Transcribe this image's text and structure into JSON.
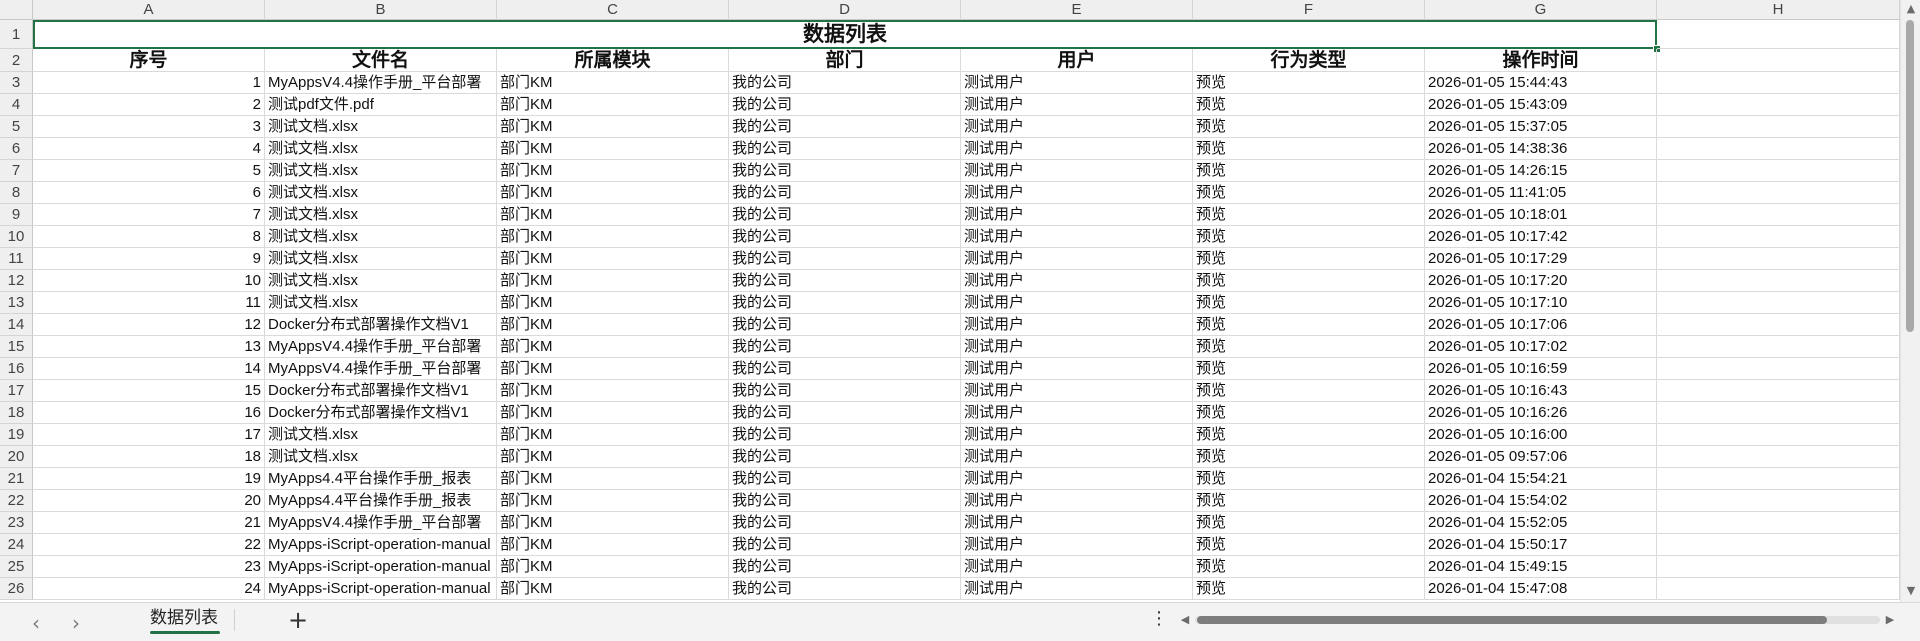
{
  "window": {
    "vscroll_up_icon": "▲",
    "vscroll_down_icon": "▼"
  },
  "sheet": {
    "columns": [
      "A",
      "B",
      "C",
      "D",
      "E",
      "F",
      "G",
      "H"
    ],
    "title": "数据列表",
    "headers": [
      "序号",
      "文件名",
      "所属模块",
      "部门",
      "用户",
      "行为类型",
      "操作时间"
    ],
    "rows": [
      [
        "1",
        "MyAppsV4.4操作手册_平台部署",
        "部门KM",
        "我的公司",
        "测试用户",
        "预览",
        "2026-01-05 15:44:43"
      ],
      [
        "2",
        "测试pdf文件.pdf",
        "部门KM",
        "我的公司",
        "测试用户",
        "预览",
        "2026-01-05 15:43:09"
      ],
      [
        "3",
        "测试文档.xlsx",
        "部门KM",
        "我的公司",
        "测试用户",
        "预览",
        "2026-01-05 15:37:05"
      ],
      [
        "4",
        "测试文档.xlsx",
        "部门KM",
        "我的公司",
        "测试用户",
        "预览",
        "2026-01-05 14:38:36"
      ],
      [
        "5",
        "测试文档.xlsx",
        "部门KM",
        "我的公司",
        "测试用户",
        "预览",
        "2026-01-05 14:26:15"
      ],
      [
        "6",
        "测试文档.xlsx",
        "部门KM",
        "我的公司",
        "测试用户",
        "预览",
        "2026-01-05 11:41:05"
      ],
      [
        "7",
        "测试文档.xlsx",
        "部门KM",
        "我的公司",
        "测试用户",
        "预览",
        "2026-01-05 10:18:01"
      ],
      [
        "8",
        "测试文档.xlsx",
        "部门KM",
        "我的公司",
        "测试用户",
        "预览",
        "2026-01-05 10:17:42"
      ],
      [
        "9",
        "测试文档.xlsx",
        "部门KM",
        "我的公司",
        "测试用户",
        "预览",
        "2026-01-05 10:17:29"
      ],
      [
        "10",
        "测试文档.xlsx",
        "部门KM",
        "我的公司",
        "测试用户",
        "预览",
        "2026-01-05 10:17:20"
      ],
      [
        "11",
        "测试文档.xlsx",
        "部门KM",
        "我的公司",
        "测试用户",
        "预览",
        "2026-01-05 10:17:10"
      ],
      [
        "12",
        "Docker分布式部署操作文档V1",
        "部门KM",
        "我的公司",
        "测试用户",
        "预览",
        "2026-01-05 10:17:06"
      ],
      [
        "13",
        "MyAppsV4.4操作手册_平台部署",
        "部门KM",
        "我的公司",
        "测试用户",
        "预览",
        "2026-01-05 10:17:02"
      ],
      [
        "14",
        "MyAppsV4.4操作手册_平台部署",
        "部门KM",
        "我的公司",
        "测试用户",
        "预览",
        "2026-01-05 10:16:59"
      ],
      [
        "15",
        "Docker分布式部署操作文档V1",
        "部门KM",
        "我的公司",
        "测试用户",
        "预览",
        "2026-01-05 10:16:43"
      ],
      [
        "16",
        "Docker分布式部署操作文档V1",
        "部门KM",
        "我的公司",
        "测试用户",
        "预览",
        "2026-01-05 10:16:26"
      ],
      [
        "17",
        "测试文档.xlsx",
        "部门KM",
        "我的公司",
        "测试用户",
        "预览",
        "2026-01-05 10:16:00"
      ],
      [
        "18",
        "测试文档.xlsx",
        "部门KM",
        "我的公司",
        "测试用户",
        "预览",
        "2026-01-05 09:57:06"
      ],
      [
        "19",
        "MyApps4.4平台操作手册_报表",
        "部门KM",
        "我的公司",
        "测试用户",
        "预览",
        "2026-01-04 15:54:21"
      ],
      [
        "20",
        "MyApps4.4平台操作手册_报表",
        "部门KM",
        "我的公司",
        "测试用户",
        "预览",
        "2026-01-04 15:54:02"
      ],
      [
        "21",
        "MyAppsV4.4操作手册_平台部署",
        "部门KM",
        "我的公司",
        "测试用户",
        "预览",
        "2026-01-04 15:52:05"
      ],
      [
        "22",
        "MyApps-iScript-operation-manual",
        "部门KM",
        "我的公司",
        "测试用户",
        "预览",
        "2026-01-04 15:50:17"
      ],
      [
        "23",
        "MyApps-iScript-operation-manual",
        "部门KM",
        "我的公司",
        "测试用户",
        "预览",
        "2026-01-04 15:49:15"
      ],
      [
        "24",
        "MyApps-iScript-operation-manual",
        "部门KM",
        "我的公司",
        "测试用户",
        "预览",
        "2026-01-04 15:47:08"
      ]
    ]
  },
  "tabbar": {
    "prev_icon": "‹",
    "next_icon": "›",
    "sheet_tab": "数据列表",
    "add_sheet_icon": "+",
    "more_icon": "⋮",
    "hscroll_left_icon": "◀",
    "hscroll_right_icon": "▶"
  },
  "colors": {
    "selection": "#217346"
  }
}
